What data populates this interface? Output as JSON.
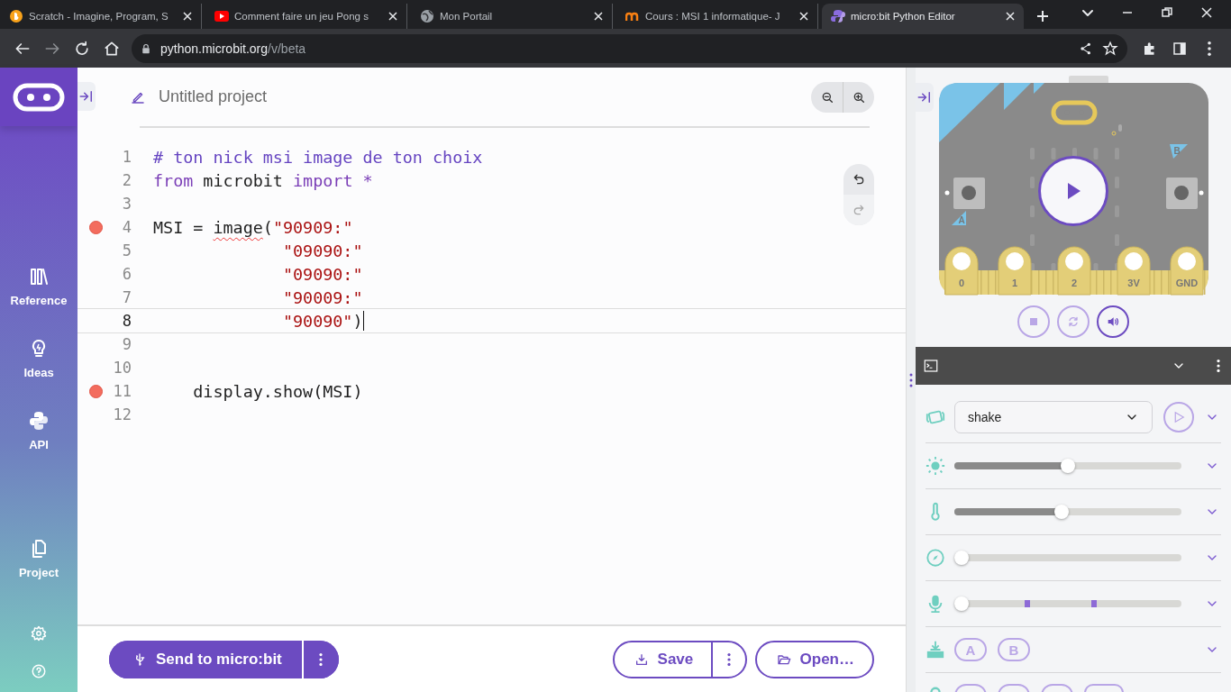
{
  "browser": {
    "tabs": [
      {
        "title": "Scratch - Imagine, Program, S",
        "kind": "scratch",
        "selected": false
      },
      {
        "title": "Comment faire un jeu Pong s",
        "kind": "video",
        "selected": false
      },
      {
        "title": "Mon Portail",
        "kind": "globe",
        "selected": false
      },
      {
        "title": "Cours : MSI 1 informatique- J",
        "kind": "course",
        "selected": false
      },
      {
        "title": "micro:bit Python Editor",
        "kind": "python",
        "selected": true
      }
    ],
    "url_host": "python.microbit.org",
    "url_path": "/v/beta"
  },
  "sidebar": {
    "items": [
      {
        "label": "Reference",
        "kind": "reference"
      },
      {
        "label": "Ideas",
        "kind": "ideas"
      },
      {
        "label": "API",
        "kind": "api"
      },
      {
        "label": "Project",
        "kind": "project"
      }
    ]
  },
  "editor": {
    "project_name": "Untitled project",
    "lines": [
      {
        "number": "1",
        "breakpoint": false,
        "current": false,
        "tokens": [
          {
            "kind": "comment",
            "text": "# ton nick msi image de ton choix"
          }
        ]
      },
      {
        "number": "2",
        "breakpoint": false,
        "current": false,
        "tokens": [
          {
            "kind": "keyword",
            "text": "from"
          },
          {
            "kind": "plain",
            "text": " microbit "
          },
          {
            "kind": "keyword",
            "text": "import"
          },
          {
            "kind": "keyword",
            "text": " *"
          }
        ]
      },
      {
        "number": "3",
        "breakpoint": false,
        "current": false
      },
      {
        "number": "4",
        "breakpoint": true,
        "current": false,
        "tokens": [
          {
            "kind": "plain",
            "text": "MSI = "
          },
          {
            "kind": "squiggle",
            "text": "image"
          },
          {
            "kind": "plain",
            "text": "("
          },
          {
            "kind": "string",
            "text": "\"90909:\""
          }
        ]
      },
      {
        "number": "5",
        "breakpoint": false,
        "current": false,
        "tokens": [
          {
            "kind": "string",
            "text": "             \"09090:\""
          }
        ]
      },
      {
        "number": "6",
        "breakpoint": false,
        "current": false,
        "tokens": [
          {
            "kind": "string",
            "text": "             \"09090:\""
          }
        ]
      },
      {
        "number": "7",
        "breakpoint": false,
        "current": false,
        "tokens": [
          {
            "kind": "string",
            "text": "             \"90009:\""
          }
        ]
      },
      {
        "number": "8",
        "breakpoint": false,
        "current": true,
        "tokens": [
          {
            "kind": "string",
            "text": "             \"90090\""
          },
          {
            "kind": "plain",
            "text": ")"
          }
        ]
      },
      {
        "number": "9",
        "breakpoint": false,
        "current": false
      },
      {
        "number": "10",
        "breakpoint": false,
        "current": false
      },
      {
        "number": "11",
        "breakpoint": true,
        "current": false,
        "tokens": [
          {
            "kind": "plain",
            "text": "    display.show(MSI)"
          }
        ]
      },
      {
        "number": "12",
        "breakpoint": false,
        "current": false
      }
    ]
  },
  "actions": {
    "send": "Send to micro:bit",
    "save": "Save",
    "open": "Open…"
  },
  "simulator": {
    "pins": [
      "0",
      "1",
      "2",
      "3V",
      "GND"
    ],
    "button_a": "A",
    "button_b": "B",
    "controls": [
      {
        "kind": "stop",
        "disabled": true
      },
      {
        "kind": "reset",
        "disabled": true
      },
      {
        "kind": "sound",
        "disabled": false
      }
    ]
  },
  "sensors": [
    {
      "kind": "gesture",
      "value": "shake"
    },
    {
      "kind": "light",
      "level": 0.5
    },
    {
      "kind": "temperature",
      "level": 0.47
    },
    {
      "kind": "compass",
      "level": 0
    },
    {
      "kind": "sound",
      "level": 0
    },
    {
      "kind": "buttons",
      "buttons": [
        "A",
        "B"
      ]
    },
    {
      "kind": "pins"
    }
  ]
}
